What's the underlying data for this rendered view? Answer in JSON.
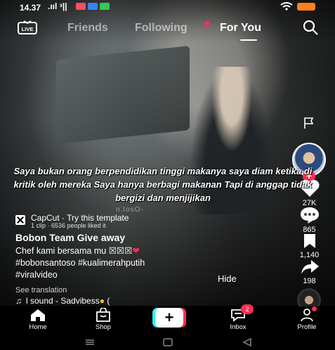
{
  "status_bar": {
    "time": "14.37",
    "signal": ".ııl ᵌ|| ",
    "app_icons": [
      {
        "name": "mail-app",
        "color": "#ff4f5e"
      },
      {
        "name": "blue-app",
        "color": "#3b82f6"
      },
      {
        "name": "green-app",
        "color": "#34c759"
      }
    ],
    "battery_color": "#ff7f1f"
  },
  "top_nav": {
    "tabs": [
      "Friends",
      "Following",
      "For You"
    ],
    "active_tab": "For You",
    "live_label": "LIVE"
  },
  "caption_overlay": "Saya bukan orang berpendidikan tinggi makanya saya diam ketika di kritik oleh mereka Saya hanya berbagi makanan Tapi di anggap tidak bergizi dan menjijikan",
  "watermark": "n.tosO-",
  "template": {
    "title": "CapCut · Try this template",
    "subtitle": "1 clip · 6536 people liked it"
  },
  "post": {
    "username": "Bobon Team Give away",
    "description_text": "Chef kami bersama mu ",
    "description_boxes": "☒☒☒",
    "description_heart": "❤",
    "hashtags_line1": "#bobonsantoso #kualimerahputih",
    "hashtags_line2": "#viralvideo",
    "hide_label": "Hide",
    "see_translation": "See translation",
    "sound_text": "l sound - Sadvibess",
    "sound_emoji": "●",
    "sound_suffix": " ("
  },
  "rail": {
    "likes": "27K",
    "comments": "865",
    "saves": "1,140",
    "shares": "198"
  },
  "bottom_nav": {
    "home": "Home",
    "shop": "Shop",
    "inbox": "Inbox",
    "inbox_badge": "2",
    "profile": "Profile",
    "create_symbol": "+"
  },
  "colors": {
    "accent_red": "#fe2c55",
    "accent_cyan": "#25f4ee"
  }
}
